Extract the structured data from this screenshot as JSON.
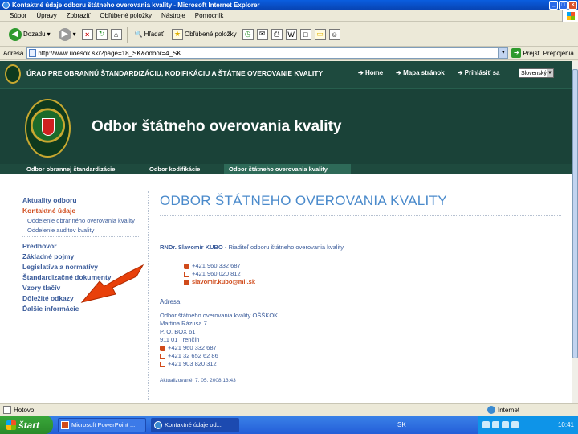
{
  "window": {
    "title": "Kontaktné údaje odboru štátneho overovania kvality - Microsoft Internet Explorer",
    "controls": [
      "_",
      "□",
      "×"
    ]
  },
  "menu": [
    "Súbor",
    "Úpravy",
    "Zobraziť",
    "Obľúbené položky",
    "Nástroje",
    "Pomocník"
  ],
  "toolbar": {
    "back": "Dozadu",
    "search": "Hľadať",
    "favorites": "Obľúbené položky"
  },
  "address": {
    "label": "Adresa",
    "url": "http://www.uoesok.sk/?page=18_SK&odbor=4_SK",
    "go": "Prejsť",
    "links": "Prepojenia"
  },
  "site": {
    "org_name": "ÚRAD PRE OBRANNÚ ŠTANDARDIZÁCIU, KODIFIKÁCIU A ŠTÁTNE OVEROVANIE KVALITY",
    "nav": [
      "Home",
      "Mapa stránok",
      "Prihlásiť sa"
    ],
    "language": "Slovenský",
    "banner_title": "Odbor štátneho overovania kvality",
    "tabs": [
      "Odbor obrannej štandardizácie",
      "Odbor kodifikácie",
      "Odbor štátneho overovania kvality"
    ]
  },
  "leftnav": {
    "items_top": [
      "Aktuality odboru"
    ],
    "active": "Kontaktné údaje",
    "sub": [
      "Oddelenie obranného overovania kvality",
      "Oddelenie auditov kvality"
    ],
    "items_bottom": [
      "Predhovor",
      "Základné pojmy",
      "Legislatíva a normatívy",
      "Štandardizačné dokumenty",
      "Vzory tlačív",
      "Dôležité odkazy",
      "Ďalšie informácie"
    ]
  },
  "main": {
    "heading": "ODBOR ŠTÁTNEHO OVEROVANIA KVALITY",
    "person_name": "RNDr. Slavomír KUBO",
    "person_role": " - Riaditeľ odboru štátneho overovania kvality",
    "phone": "+421 960 332 687",
    "fax": "+421 960 020 812",
    "email": "slavomir.kubo@mil.sk",
    "address_label": "Adresa:",
    "address_lines": [
      "Odbor štátneho overovania kvality OŠŠKOK",
      "Martina Rázusa 7",
      "P. O. BOX 61",
      "911 01 Trenčín"
    ],
    "contact_phone": "+421 960 332 687",
    "contact_fax": "+421 32 652 62 86",
    "contact_fax2": "+421 903 820 312",
    "updated": "Aktualizované: 7. 05. 2008 13:43"
  },
  "statusbar": {
    "status": "Hotovo",
    "zone": "Internet"
  },
  "taskbar": {
    "start": "štart",
    "tasks": [
      "Microsoft PowerPoint ...",
      "Kontaktné údaje od..."
    ],
    "language": "SK",
    "clock": "10:41"
  }
}
